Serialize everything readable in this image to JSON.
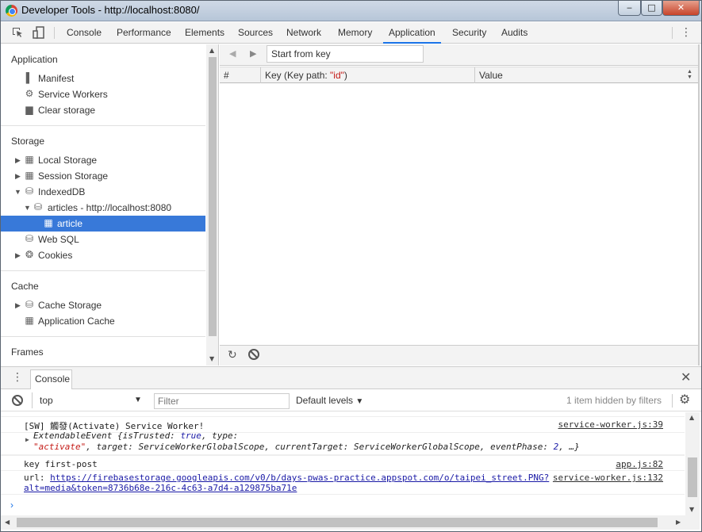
{
  "window": {
    "title": "Developer Tools - http://localhost:8080/",
    "min_label": "‒",
    "max_label": "□",
    "close_label": "✕"
  },
  "toolbar": {
    "tabs": [
      {
        "label": "Console"
      },
      {
        "label": "Performance"
      },
      {
        "label": "Elements"
      },
      {
        "label": "Sources"
      },
      {
        "label": "Network"
      },
      {
        "label": "Memory"
      },
      {
        "label": "Application",
        "active": true
      },
      {
        "label": "Security"
      },
      {
        "label": "Audits"
      }
    ]
  },
  "sidebar": {
    "application": {
      "heading": "Application",
      "items": [
        {
          "label": "Manifest",
          "icon": "document-icon"
        },
        {
          "label": "Service Workers",
          "icon": "gear-icon"
        },
        {
          "label": "Clear storage",
          "icon": "trash-icon"
        }
      ]
    },
    "storage": {
      "heading": "Storage",
      "items": [
        {
          "label": "Local Storage",
          "icon": "grid-icon"
        },
        {
          "label": "Session Storage",
          "icon": "grid-icon"
        },
        {
          "label": "IndexedDB",
          "icon": "database-icon"
        },
        {
          "label": "articles - http://localhost:8080",
          "icon": "database-icon"
        },
        {
          "label": "article",
          "icon": "grid-icon",
          "selected": true
        },
        {
          "label": "Web SQL",
          "icon": "database-icon"
        },
        {
          "label": "Cookies",
          "icon": "cookie-icon"
        }
      ]
    },
    "cache": {
      "heading": "Cache",
      "items": [
        {
          "label": "Cache Storage",
          "icon": "database-icon"
        },
        {
          "label": "Application Cache",
          "icon": "grid-icon"
        }
      ]
    },
    "frames": {
      "heading": "Frames"
    }
  },
  "main": {
    "key_placeholder": "Start from key",
    "columns": {
      "num": "#",
      "key_prefix": "Key (Key path: ",
      "key_path": "\"id\"",
      "key_suffix": ")",
      "value": "Value"
    }
  },
  "drawer": {
    "tab": "Console",
    "context": "top",
    "filter_placeholder": "Filter",
    "levels": "Default levels",
    "hidden_info": "1 item hidden by filters",
    "messages": [
      {
        "text": "[SW] 觸發(Activate) Service Worker!",
        "source": "service-worker.js:39"
      },
      {
        "event_line1_a": "ExtendableEvent {isTrusted: ",
        "event_true": "true",
        "event_line1_b": ", type:",
        "event_type": "\"activate\"",
        "event_line2_b": ", target: ServiceWorkerGlobalScope, currentTarget: ServiceWorkerGlobalScope, eventPhase: ",
        "event_phase": "2",
        "event_line2_c": ", …}"
      },
      {
        "text": "key first-post",
        "source": "app.js:82"
      },
      {
        "prefix": "url: ",
        "url1": "https://firebasestorage.googleapis.com/v0/b/days-pwas-practice.appspot.com/o/taipei_street.PNG?",
        "url2": "alt=media&token=8736b68e-216c-4c63-a7d4-a129875ba71e",
        "source": "service-worker.js:132"
      }
    ]
  },
  "colors": {
    "accent": "#1a73e8",
    "selection": "#3879d9"
  }
}
